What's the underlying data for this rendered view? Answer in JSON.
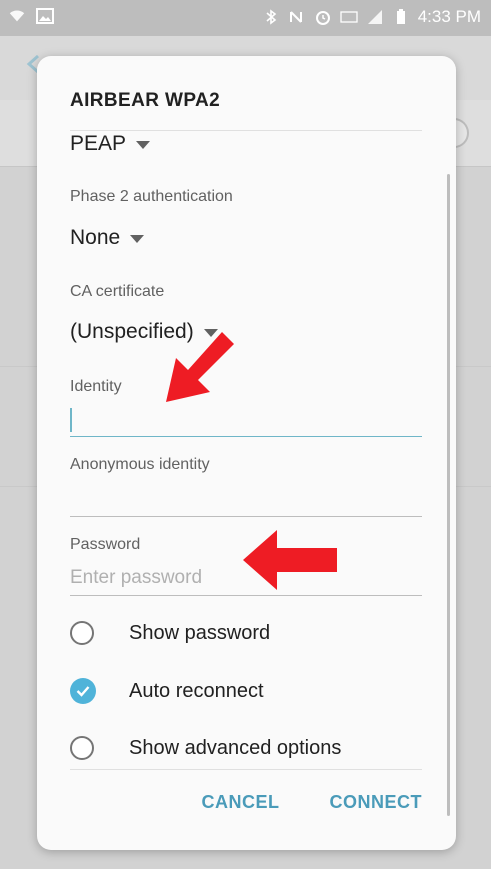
{
  "status_bar": {
    "time": "4:33 PM"
  },
  "dialog": {
    "title": "AIRBEAR WPA2",
    "eap_method": "PEAP",
    "phase2_label": "Phase 2 authentication",
    "phase2_value": "None",
    "ca_label": "CA certificate",
    "ca_value": "(Unspecified)",
    "identity_label": "Identity",
    "identity_value": "",
    "anon_label": "Anonymous identity",
    "anon_value": "",
    "password_label": "Password",
    "password_placeholder": "Enter password",
    "options": [
      {
        "label": "Show password",
        "checked": false
      },
      {
        "label": "Auto reconnect",
        "checked": true
      },
      {
        "label": "Show advanced options",
        "checked": false
      }
    ],
    "cancel_label": "CANCEL",
    "connect_label": "CONNECT"
  },
  "colors": {
    "accent": "#4a9bb9",
    "checkbox": "#4fb3d9",
    "annotation_arrow": "#ee1c24"
  }
}
